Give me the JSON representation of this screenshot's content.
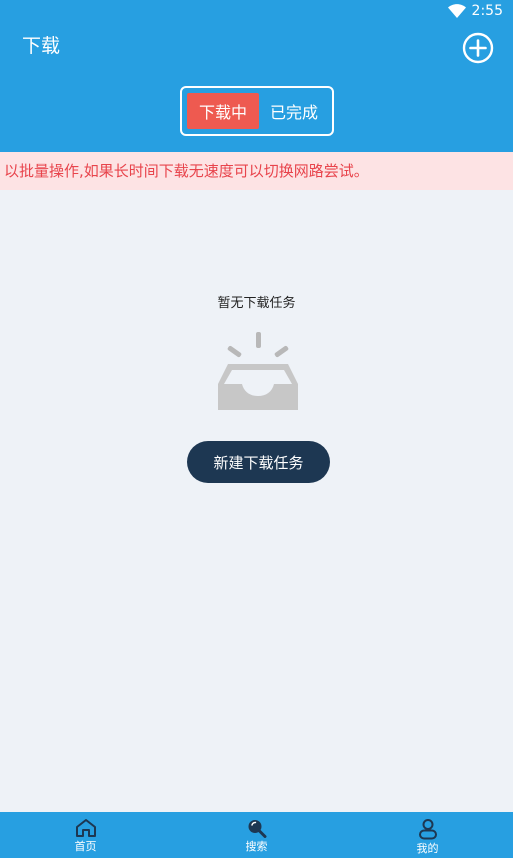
{
  "status_bar": {
    "time": "2:55",
    "wifi_icon": "wifi-icon"
  },
  "header": {
    "title": "下载",
    "add_icon": "add-circle-icon",
    "tabs": [
      {
        "label": "下载中",
        "active": true
      },
      {
        "label": "已完成",
        "active": false
      }
    ]
  },
  "notice": {
    "text": "以批量操作,如果长时间下载无速度可以切换网路尝试。"
  },
  "empty_state": {
    "message": "暂无下载任务",
    "illustration_icon": "empty-inbox-icon",
    "button_label": "新建下载任务"
  },
  "bottom_nav": {
    "items": [
      {
        "label": "首页",
        "icon": "home-icon"
      },
      {
        "label": "搜索",
        "icon": "search-icon"
      },
      {
        "label": "我的",
        "icon": "user-icon"
      }
    ]
  },
  "colors": {
    "primary": "#279fe1",
    "active_tab": "#ee5a50",
    "notice_bg": "#fde3e4",
    "notice_text": "#e8444c",
    "button_dark": "#1d3752",
    "background": "#eef2f7"
  }
}
